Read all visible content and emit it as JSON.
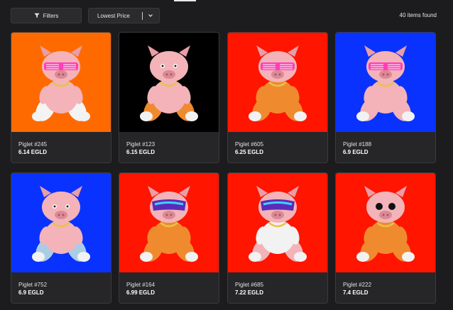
{
  "toolbar": {
    "filters_label": "Filters",
    "sort_value": "Lowest Price",
    "result_count": "40 items found"
  },
  "items": [
    {
      "name": "Piglet #245",
      "price": "6.14 EGLD",
      "bg": "#ff6a00",
      "outfit": "diaper",
      "eyewear": "pink-shutter"
    },
    {
      "name": "Piglet #123",
      "price": "6.15 EGLD",
      "bg": "#000000",
      "outfit": "orange-pants",
      "eyewear": "none"
    },
    {
      "name": "Piglet #605",
      "price": "6.25 EGLD",
      "bg": "#ff1500",
      "outfit": "orange-suit",
      "eyewear": "pink-shutter"
    },
    {
      "name": "Piglet #188",
      "price": "6.9 EGLD",
      "bg": "#0a32ff",
      "outfit": "none",
      "eyewear": "pink-shutter"
    },
    {
      "name": "Piglet #752",
      "price": "6.9 EGLD",
      "bg": "#0a32ff",
      "outfit": "jeans",
      "eyewear": "none"
    },
    {
      "name": "Piglet #164",
      "price": "6.99 EGLD",
      "bg": "#ff1500",
      "outfit": "orange-suit",
      "eyewear": "visor"
    },
    {
      "name": "Piglet #685",
      "price": "7.22 EGLD",
      "bg": "#ff1500",
      "outfit": "white-tee",
      "eyewear": "visor"
    },
    {
      "name": "Piglet #222",
      "price": "7.4 EGLD",
      "bg": "#ff1500",
      "outfit": "orange-suit",
      "eyewear": "round-black"
    }
  ]
}
